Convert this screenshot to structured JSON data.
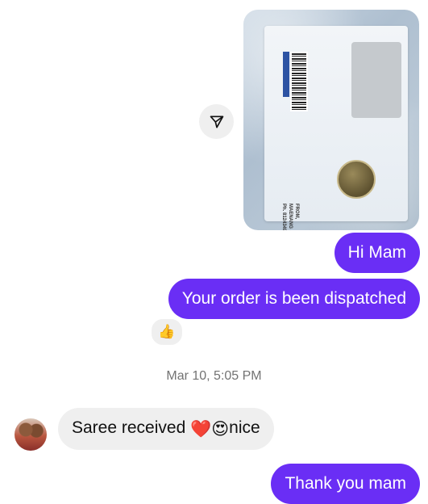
{
  "thread": {
    "photo": {
      "envelope_text": "FROM,\nMAENANG STUDIO\nPh. 8124349180"
    },
    "share_button": {
      "icon": "send-arrow-icon"
    },
    "messages": [
      {
        "direction": "outgoing",
        "text": "Hi Mam"
      },
      {
        "direction": "outgoing",
        "text": "Your order is been dispatched"
      },
      {
        "direction": "incoming",
        "text_before": "Saree received",
        "emojis": [
          "❤️",
          "😍"
        ],
        "text_after": "nice"
      },
      {
        "direction": "outgoing",
        "text": "Thank you mam"
      }
    ],
    "reaction": {
      "emoji": "👍"
    },
    "timestamp": "Mar 10, 5:05 PM"
  },
  "colors": {
    "outgoing_bubble": "#6a2ef5",
    "incoming_bubble": "#efefef",
    "timestamp": "#737373"
  }
}
